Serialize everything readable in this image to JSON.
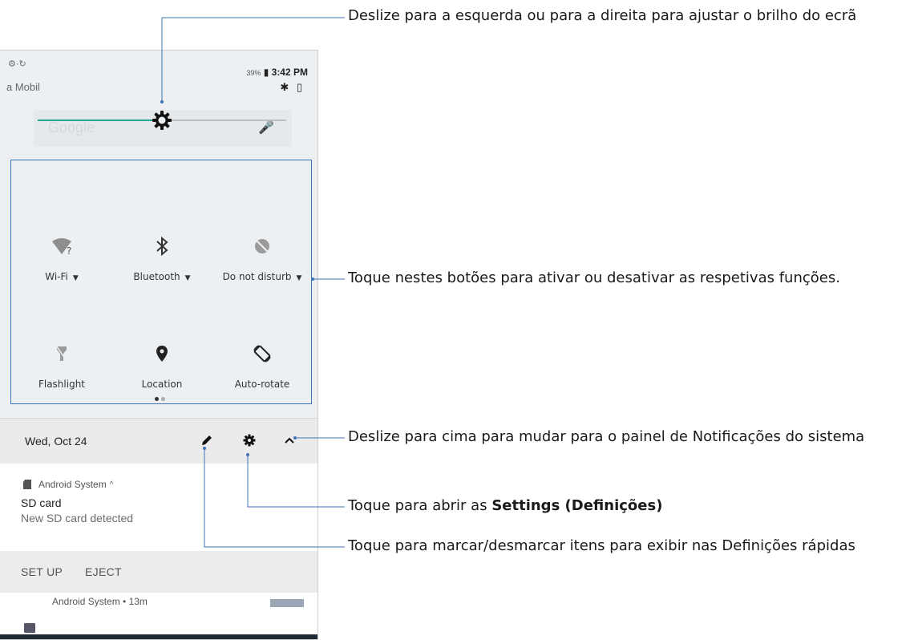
{
  "status": {
    "left_icons": "⚙·↻",
    "carrier": "a Mobil",
    "battery": "39%",
    "time": "3:42 PM",
    "sys_icons": "✱ ▯"
  },
  "search_ghost": {
    "text": "Google",
    "mic": "🎤"
  },
  "brightness": {
    "level": 0.5
  },
  "tiles": [
    {
      "label": "Wi-Fi",
      "icon": "wifi-icon",
      "dropdown": true
    },
    {
      "label": "Bluetooth",
      "icon": "bluetooth-icon",
      "dropdown": true
    },
    {
      "label": "Do not disturb",
      "icon": "do-not-disturb-icon",
      "dropdown": true
    },
    {
      "label": "Flashlight",
      "icon": "flashlight-icon",
      "dropdown": false
    },
    {
      "label": "Location",
      "icon": "location-icon",
      "dropdown": false
    },
    {
      "label": "Auto-rotate",
      "icon": "auto-rotate-icon",
      "dropdown": false
    }
  ],
  "pager": {
    "pages": 2,
    "active": 1
  },
  "date_row": {
    "date": "Wed, Oct 24"
  },
  "notification": {
    "app": "Android System",
    "title": "SD card",
    "text": "New SD card detected",
    "actions": [
      "SET UP",
      "EJECT"
    ]
  },
  "notification2": {
    "app": "Android System • 13m"
  },
  "callouts": {
    "brightness": "Deslize para a esquerda ou para a direita para ajustar o brilho do ecrã",
    "toggles": "Toque nestes botões para ativar ou desativar as respetivas funções.",
    "swipe_up": "Deslize para cima para mudar para o painel de Notificações do sistema",
    "settings_prefix": "Toque para abrir as",
    "settings_bold": "Settings (Definições)",
    "edit": "Toque para marcar/desmarcar itens para exibir nas Definições rápidas"
  },
  "colors": {
    "accent": "#26a69a",
    "callout_line": "#3f72b8",
    "panel_bg": "#edf0f3"
  }
}
